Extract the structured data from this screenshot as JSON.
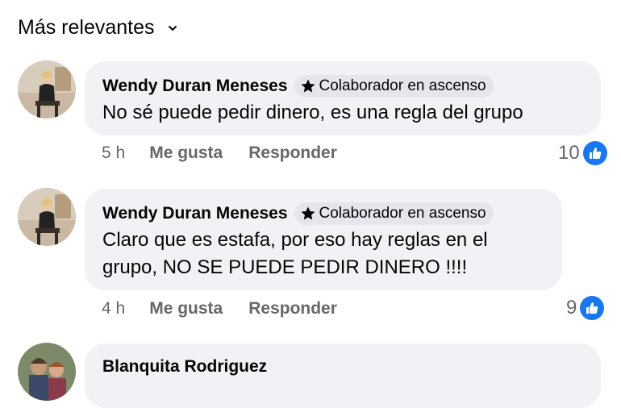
{
  "sort": {
    "label": "Más relevantes"
  },
  "comments": [
    {
      "author": "Wendy Duran Meneses",
      "badge": "Colaborador en ascenso",
      "text": "No sé puede pedir dinero, es una regla del grupo",
      "time": "5 h",
      "like_label": "Me gusta",
      "reply_label": "Responder",
      "reaction_count": "10"
    },
    {
      "author": "Wendy Duran Meneses",
      "badge": "Colaborador en ascenso",
      "text": "Claro que es estafa, por eso hay reglas en el grupo, NO SE PUEDE PEDIR DINERO !!!!",
      "time": "4 h",
      "like_label": "Me gusta",
      "reply_label": "Responder",
      "reaction_count": "9"
    },
    {
      "author": "Blanquita Rodriguez"
    }
  ],
  "colors": {
    "bubble": "#f0f2f5",
    "badge": "#e4e6eb",
    "like_blue": "#1877f2",
    "meta_gray": "#65676b"
  }
}
